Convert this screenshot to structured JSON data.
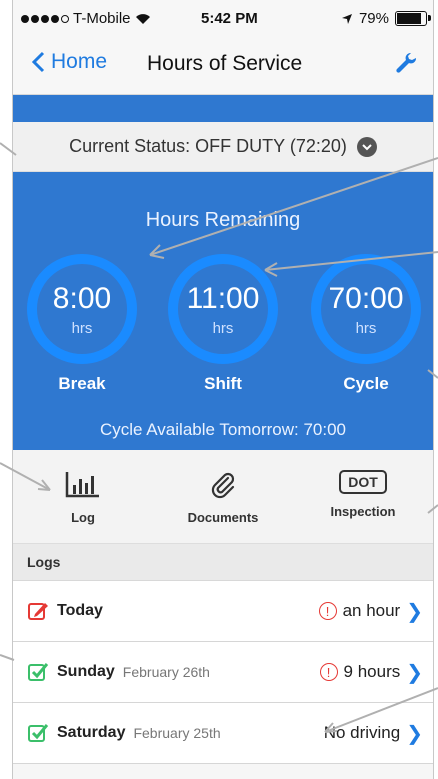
{
  "status_bar": {
    "carrier": "T-Mobile",
    "time": "5:42 PM",
    "battery": "79%"
  },
  "nav": {
    "back_label": "Home",
    "title": "Hours of Service"
  },
  "current_status": "Current Status: OFF DUTY (72:20)",
  "hours": {
    "title": "Hours Remaining",
    "gauges": [
      {
        "value": "8:00",
        "unit": "hrs",
        "label": "Break"
      },
      {
        "value": "11:00",
        "unit": "hrs",
        "label": "Shift"
      },
      {
        "value": "70:00",
        "unit": "hrs",
        "label": "Cycle"
      }
    ],
    "cycle_note": "Cycle Available Tomorrow: 70:00"
  },
  "actions": {
    "log": "Log",
    "documents": "Documents",
    "inspection": "Inspection",
    "dot_badge": "DOT"
  },
  "logs": {
    "header": "Logs",
    "rows": [
      {
        "day": "Today",
        "date": "",
        "value": "an hour"
      },
      {
        "day": "Sunday",
        "date": "February 26th",
        "value": "9 hours"
      },
      {
        "day": "Saturday",
        "date": "February 25th",
        "value": "No driving"
      }
    ]
  },
  "colors": {
    "accent": "#1f7be0",
    "panel": "#2f78d0",
    "ring": "#1a8bff",
    "warning": "#e53935",
    "check": "#3bbf6a"
  }
}
